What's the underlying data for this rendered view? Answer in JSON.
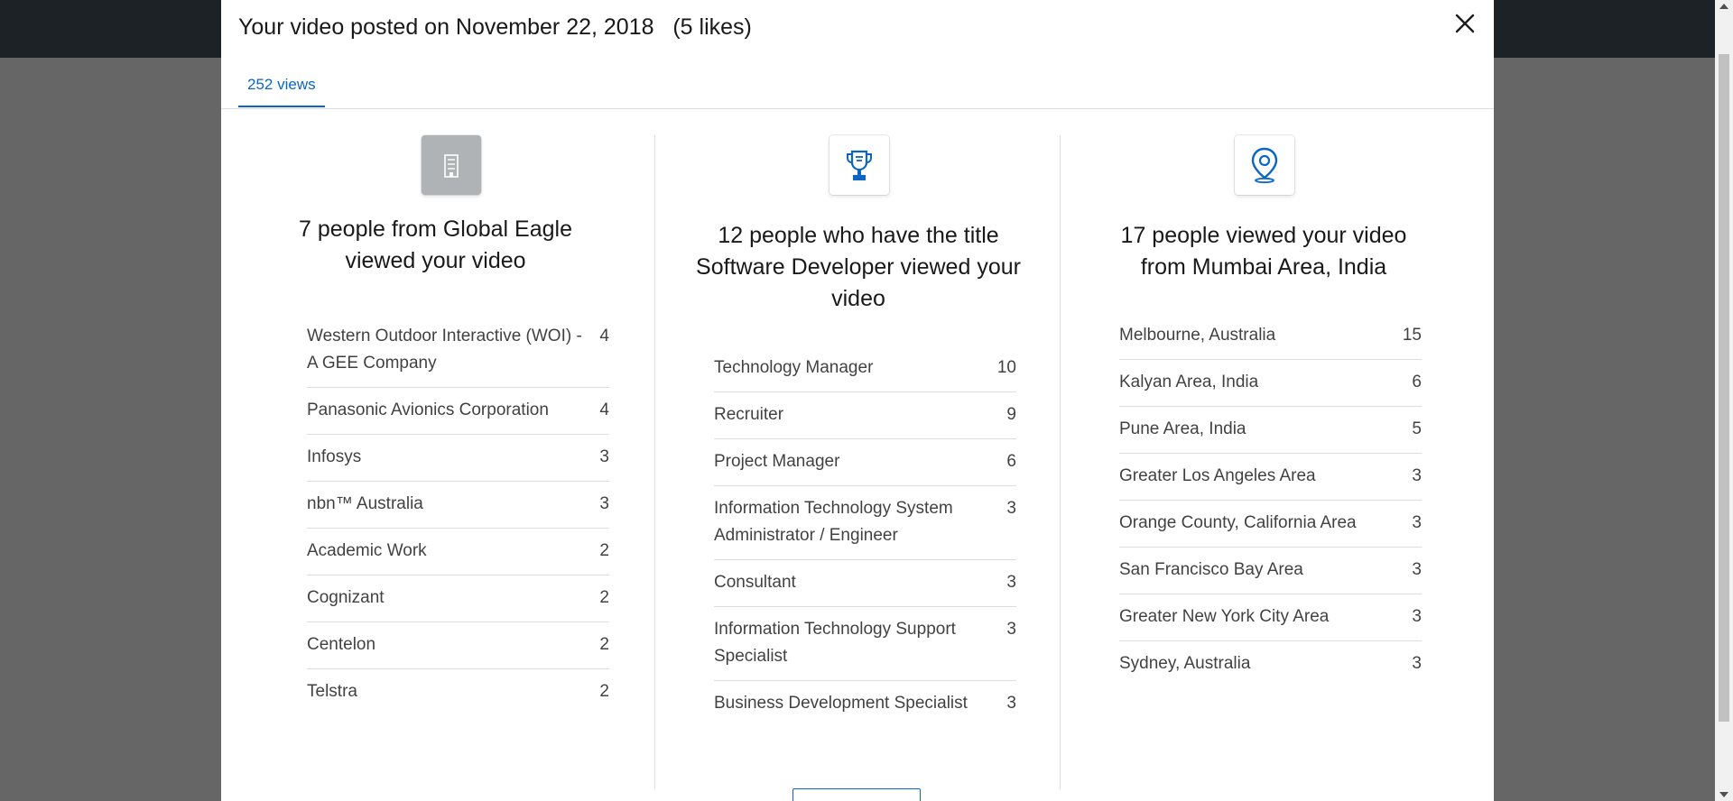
{
  "modal": {
    "title": "Your video posted on November 22, 2018   (5 likes)",
    "tab_label": "252 views",
    "close_icon": "close-icon"
  },
  "colors": {
    "accent": "#0a66c2",
    "backdrop": "#666666",
    "topbar": "#1d2226"
  },
  "companies": {
    "icon": "building-icon",
    "title": "7 people from Global Eagle viewed your video",
    "items": [
      {
        "label": "Western Outdoor Interactive (WOI) - A GEE Company",
        "count": "4"
      },
      {
        "label": "Panasonic Avionics Corporation",
        "count": "4"
      },
      {
        "label": "Infosys",
        "count": "3"
      },
      {
        "label": "nbn™ Australia",
        "count": "3"
      },
      {
        "label": "Academic Work",
        "count": "2"
      },
      {
        "label": "Cognizant",
        "count": "2"
      },
      {
        "label": "Centelon",
        "count": "2"
      },
      {
        "label": "Telstra",
        "count": "2"
      }
    ]
  },
  "titles": {
    "icon": "trophy-icon",
    "title": "12 people who have the title Software Developer viewed your video",
    "items": [
      {
        "label": "Technology Manager",
        "count": "10"
      },
      {
        "label": "Recruiter",
        "count": "9"
      },
      {
        "label": "Project Manager",
        "count": "6"
      },
      {
        "label": "Information Technology System Administrator / Engineer",
        "count": "3"
      },
      {
        "label": "Consultant",
        "count": "3"
      },
      {
        "label": "Information Technology Support Specialist",
        "count": "3"
      },
      {
        "label": "Business Development Specialist",
        "count": "3"
      }
    ]
  },
  "locations": {
    "icon": "location-pin-icon",
    "title": "17 people viewed your video from Mumbai Area, India",
    "items": [
      {
        "label": "Melbourne, Australia",
        "count": "15"
      },
      {
        "label": "Kalyan Area, India",
        "count": "6"
      },
      {
        "label": "Pune Area, India",
        "count": "5"
      },
      {
        "label": "Greater Los Angeles Area",
        "count": "3"
      },
      {
        "label": "Orange County, California Area",
        "count": "3"
      },
      {
        "label": "San Francisco Bay Area",
        "count": "3"
      },
      {
        "label": "Greater New York City Area",
        "count": "3"
      },
      {
        "label": "Sydney, Australia",
        "count": "3"
      }
    ]
  }
}
